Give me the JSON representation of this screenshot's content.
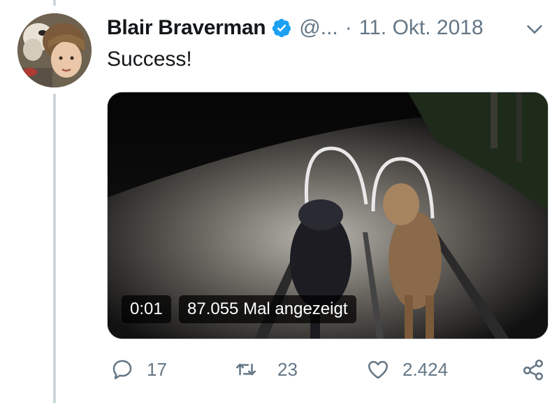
{
  "tweet": {
    "author_name": "Blair Braverman",
    "handle": "@...",
    "separator": "·",
    "date": "11. Okt. 2018",
    "text": "Success!"
  },
  "media": {
    "timestamp": "0:01",
    "views": "87.055 Mal angezeigt"
  },
  "actions": {
    "replies": "17",
    "retweets": "23",
    "likes": "2.424"
  },
  "colors": {
    "verified": "#1da1f2",
    "muted": "#657786",
    "thread_line": "#ccd6dd"
  },
  "icons": [
    "verified-badge-icon",
    "chevron-down-icon",
    "reply-icon",
    "retweet-icon",
    "like-icon",
    "share-icon"
  ]
}
